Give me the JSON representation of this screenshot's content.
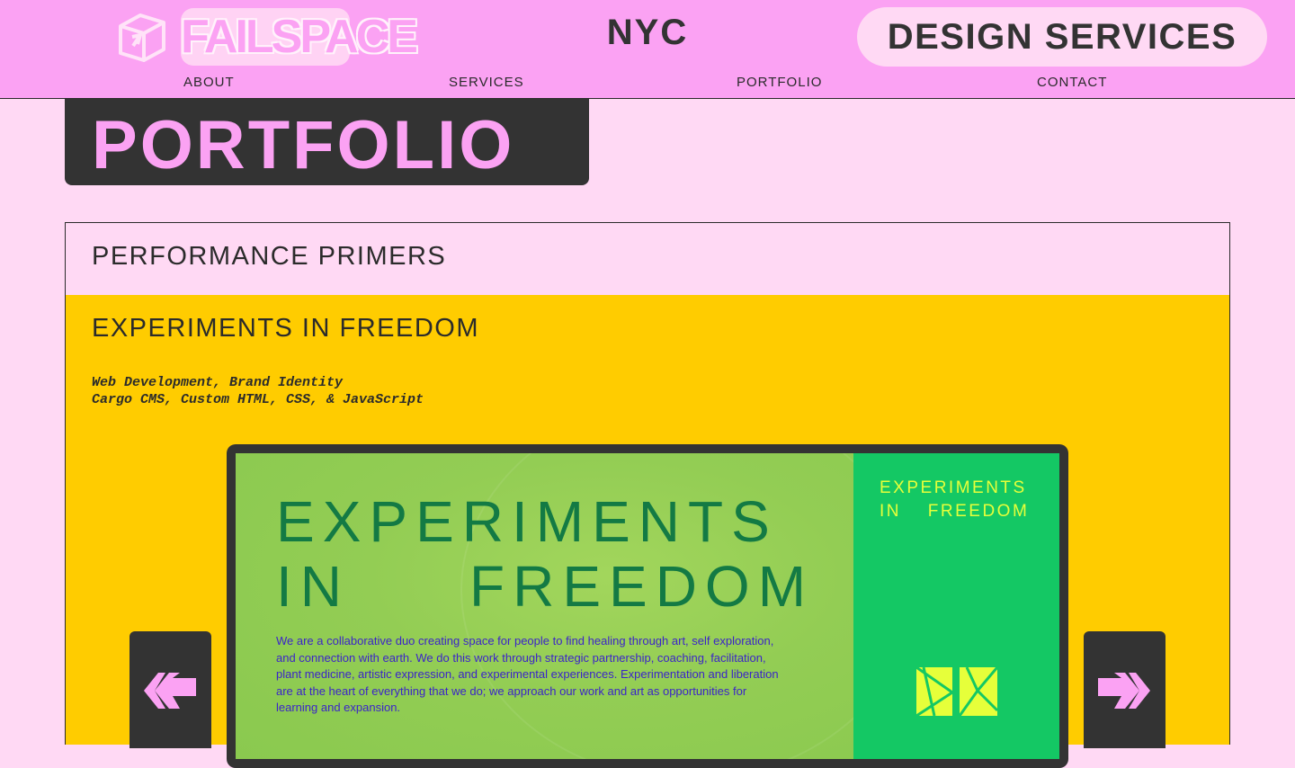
{
  "header": {
    "logo_text": "FAILSPACE",
    "city": "NYC",
    "design_services": "DESIGN SERVICES",
    "nav": [
      {
        "label": "ABOUT"
      },
      {
        "label": "SERVICES"
      },
      {
        "label": "PORTFOLIO"
      },
      {
        "label": "CONTACT"
      }
    ]
  },
  "page": {
    "title": "PORTFOLIO"
  },
  "projects": [
    {
      "title": "PERFORMANCE PRIMERS"
    },
    {
      "title": "EXPERIMENTS IN FREEDOM",
      "tags": "Web Development, Brand Identity",
      "tech": "Cargo CMS, Custom HTML, CSS, & JavaScript",
      "preview": {
        "title_line1": "EXPERIMENTS",
        "title_line2_a": "IN",
        "title_line2_b": "FREEDOM",
        "description": "We are a collaborative duo creating space for people to find healing through art, self exploration, and connection with earth. We do this work through strategic partnership, coaching, facilitation, plant medicine, artistic expression, and experimental experiences. Experimentation and liberation are at the heart of everything that we do; we approach our work and art as opportunities for learning and expansion.",
        "side_title_line1": "EXPERIMENTS",
        "side_title_line2": "IN FREEDOM"
      }
    }
  ],
  "colors": {
    "header_bg": "#fba2f3",
    "page_bg": "#ffd9f4",
    "dark": "#333333",
    "accordion_active": "#ffcc00",
    "preview_green": "#8ac94f",
    "preview_side": "#14c864",
    "preview_accent": "#e6ff3a"
  },
  "icons": {
    "logo": "cube-icon",
    "prev": "arrow-left-icon",
    "next": "arrow-right-icon"
  }
}
